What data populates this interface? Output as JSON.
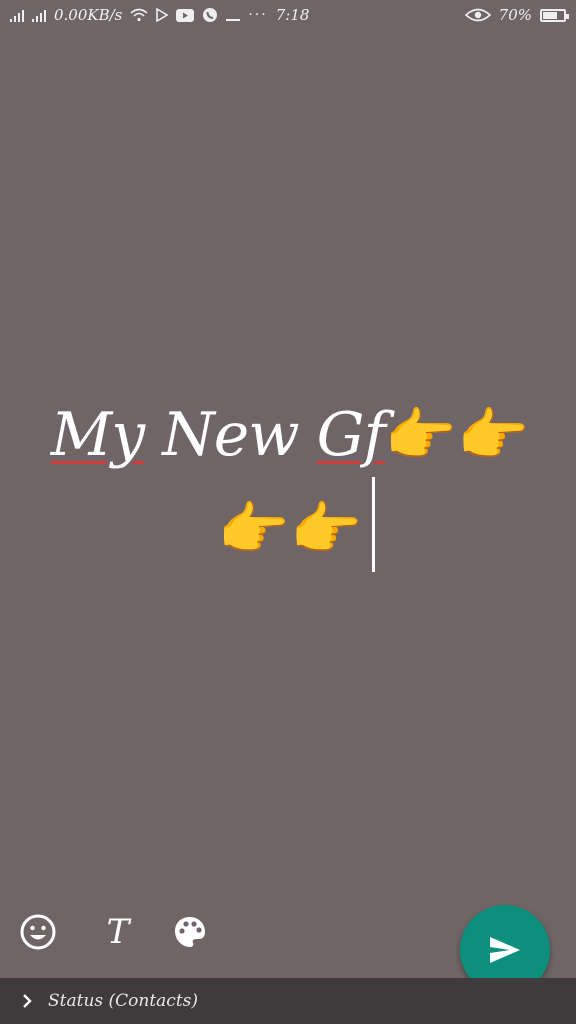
{
  "status_bar": {
    "network_speed": "0.00KB/s",
    "time": "7:18",
    "battery_percent": "70%",
    "battery_level": 0.7
  },
  "editor": {
    "line1_word1": "My",
    "line1_word2": "New",
    "line1_word3": "Gf",
    "line1_emojis": "👉👉",
    "line2_emojis": "👉👉"
  },
  "toolbar": {
    "text_tool_label": "T"
  },
  "footer": {
    "audience_label": "Status (Contacts)"
  },
  "colors": {
    "background": "#6f6566",
    "send_button": "#0c8f7d",
    "spellcheck_underline": "#d23b3b",
    "footer_bar": "#3f3b3c"
  },
  "icons": [
    "signal-icon",
    "wifi-icon",
    "play-store-icon",
    "youtube-icon",
    "whatsapp-icon",
    "more-icon",
    "eye-icon",
    "battery-icon",
    "emoji-icon",
    "palette-icon",
    "send-icon",
    "chevron-right-icon"
  ]
}
